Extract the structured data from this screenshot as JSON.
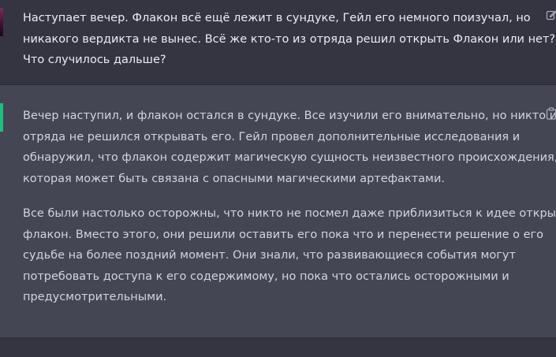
{
  "conversation": {
    "user_message": {
      "lines": [
        "Наступает вечер. Флакон всё ещё лежит в сундуке, Гейл его немного поизучал, но",
        "никакого вердикта не вынес. Всё же кто-то из отряда решил открыть Флакон или нет?",
        "Что случилось дальше?"
      ],
      "action_icon": "edit-icon"
    },
    "assistant_message": {
      "paragraphs": [
        [
          "Вечер наступил, и флакон остался в сундуке. Все изучили его внимательно, но никто из",
          "отряда не решился открывать его. Гейл провел дополнительные исследования и",
          "обнаружил, что флакон содержит магическую сущность неизвестного происхождения,",
          "которая может быть связана с опасными магическими артефактами."
        ],
        [
          "Все были настолько осторожны, что никто не посмел даже приблизиться к идее открыть",
          "флакон. Вместо этого, они решили оставить его пока что и перенести решение о его",
          "судьбе на более поздний момент. Они знали, что развивающиеся события могут",
          "потребовать доступа к его содержимому, но пока что остались осторожными и",
          "предусмотрительными."
        ]
      ],
      "action_icon": "copy-icon"
    }
  },
  "colors": {
    "user_bg": "#343541",
    "assistant_bg": "#444654",
    "assistant_accent": "#19c37d",
    "text": "#ececf1"
  }
}
